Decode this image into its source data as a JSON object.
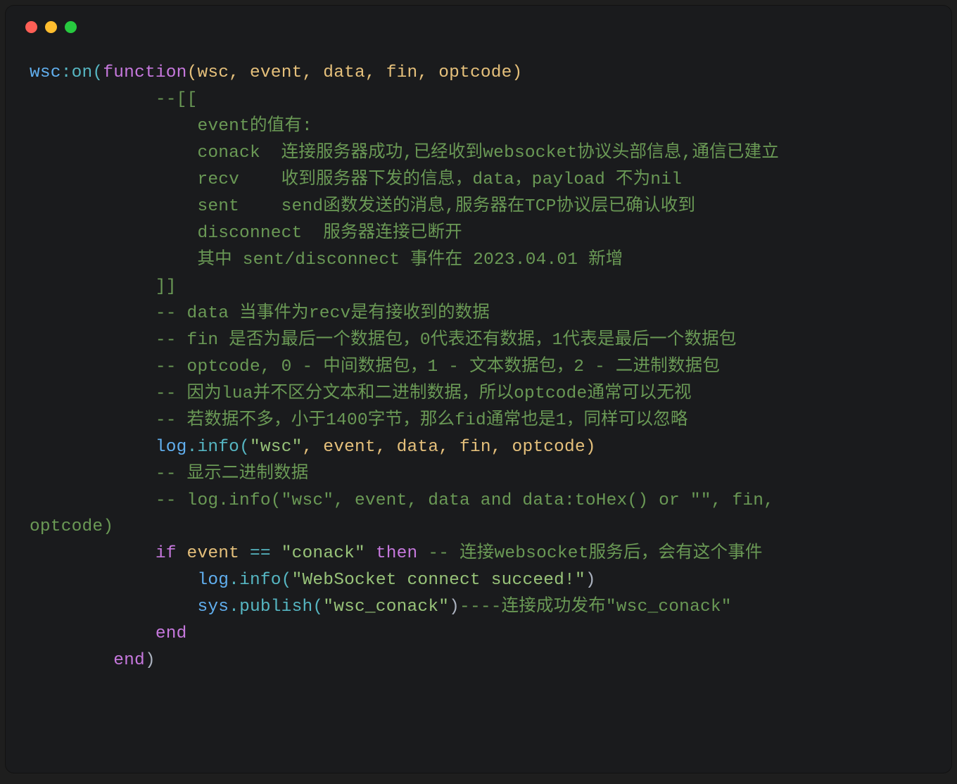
{
  "window": {
    "controls": [
      "close",
      "minimize",
      "zoom"
    ]
  },
  "code": {
    "l1": {
      "a": "wsc",
      "b": ":on(",
      "c": "function",
      "d": "(wsc, event, data, fin, optcode)"
    },
    "l2": "            --[[",
    "l3": "                event的值有:",
    "l4": "                conack  连接服务器成功,已经收到websocket协议头部信息,通信已建立",
    "l5": "                recv    收到服务器下发的信息，data，payload 不为nil",
    "l6": "                sent    send函数发送的消息,服务器在TCP协议层已确认收到",
    "l7": "                disconnect  服务器连接已断开",
    "l8": "                其中 sent/disconnect 事件在 2023.04.01 新增",
    "l9": "            ]]",
    "l10": "            -- data 当事件为recv是有接收到的数据",
    "l11": "            -- fin 是否为最后一个数据包，0代表还有数据，1代表是最后一个数据包",
    "l12": "            -- optcode, 0 - 中间数据包，1 - 文本数据包，2 - 二进制数据包",
    "l13": "            -- 因为lua并不区分文本和二进制数据，所以optcode通常可以无视",
    "l14": "            -- 若数据不多，小于1400字节，那么fid通常也是1，同样可以忽略",
    "l15": {
      "pad": "            ",
      "a": "log",
      "b": ".info(",
      "c": "\"wsc\"",
      "d": ", event, data, fin, optcode)"
    },
    "l16": "            -- 显示二进制数据",
    "l17": "            -- log.info(\"wsc\", event, data and data:toHex() or \"\", fin, optcode)",
    "l17b": "optcode)",
    "l17a": "            -- log.info(\"wsc\", event, data and data:toHex() or \"\", fin, ",
    "l18": {
      "pad": "            ",
      "a": "if",
      "b": " event ",
      "c": "==",
      "d": " ",
      "e": "\"conack\"",
      "f": " ",
      "g": "then",
      "h": " -- 连接websocket服务后，会有这个事件"
    },
    "l19": {
      "pad": "                ",
      "a": "log",
      "b": ".info(",
      "c": "\"WebSocket connect succeed!\"",
      "d": ")"
    },
    "l20": {
      "pad": "                ",
      "a": "sys",
      "b": ".publish(",
      "c": "\"wsc_conack\"",
      "d": ")",
      "e": "----连接成功发布\"wsc_conack\""
    },
    "l21": {
      "pad": "            ",
      "a": "end"
    },
    "l22": {
      "pad": "        ",
      "a": "end",
      "b": ")"
    }
  }
}
